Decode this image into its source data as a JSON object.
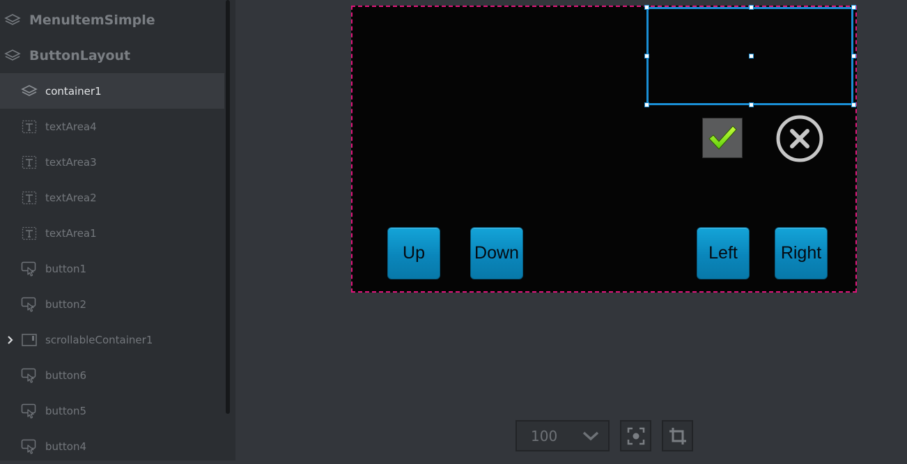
{
  "layers_panel": {
    "screens": [
      {
        "label": "MenuItemSimple",
        "icon": "layers-icon"
      },
      {
        "label": "ButtonLayout",
        "icon": "layers-icon"
      }
    ],
    "items": [
      {
        "label": "container1",
        "icon": "layers-icon",
        "selected": true
      },
      {
        "label": "textArea4",
        "icon": "text-area-icon"
      },
      {
        "label": "textArea3",
        "icon": "text-area-icon"
      },
      {
        "label": "textArea2",
        "icon": "text-area-icon"
      },
      {
        "label": "textArea1",
        "icon": "text-area-icon"
      },
      {
        "label": "button1",
        "icon": "button-icon"
      },
      {
        "label": "button2",
        "icon": "button-icon"
      },
      {
        "label": "scrollableContainer1",
        "icon": "scrollable-container-icon",
        "expandable": true
      },
      {
        "label": "button6",
        "icon": "button-icon"
      },
      {
        "label": "button5",
        "icon": "button-icon"
      },
      {
        "label": "button4",
        "icon": "button-icon"
      }
    ]
  },
  "canvas": {
    "buttons": {
      "up": "Up",
      "down": "Down",
      "left": "Left",
      "right": "Right"
    },
    "checkbox_icon": "checkmark-icon",
    "close_icon": "close-circle-icon",
    "colors": {
      "frame_border": "#e0147a",
      "selection": "#1a8fd6",
      "button_fill": "#0a8bc1",
      "check_green": "#8ef01a"
    }
  },
  "toolbar": {
    "zoom_value": "100",
    "fit_icon": "focus-icon",
    "crop_icon": "crop-icon"
  }
}
